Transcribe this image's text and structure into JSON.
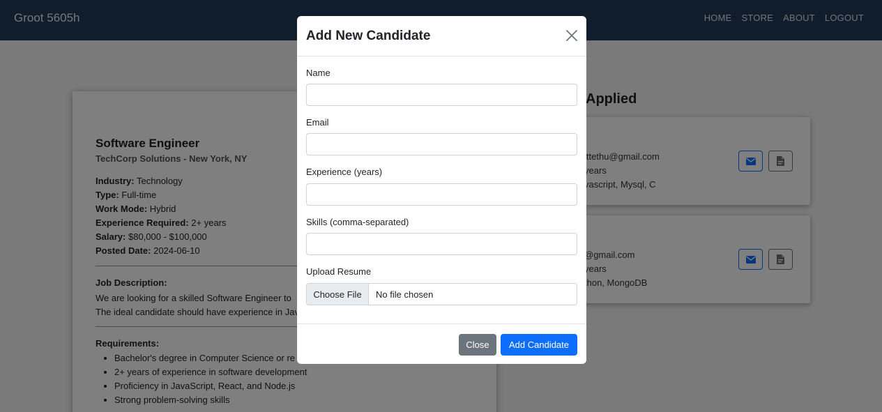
{
  "navbar": {
    "brand": "Groot 5605h",
    "links": [
      "HOME",
      "STORE",
      "ABOUT",
      "LOGOUT"
    ]
  },
  "job": {
    "title": "Software Engineer",
    "company": "TechCorp Solutions - New York, NY",
    "details": [
      {
        "label": "Industry:",
        "value": "Technology"
      },
      {
        "label": "Type:",
        "value": "Full-time"
      },
      {
        "label": "Work Mode:",
        "value": "Hybrid"
      },
      {
        "label": "Experience Required:",
        "value": "2+ years"
      },
      {
        "label": "Salary:",
        "value": "$80,000 - $100,000"
      },
      {
        "label": "Posted Date:",
        "value": "2024-06-10"
      }
    ],
    "description_label": "Job Description:",
    "description_lines": [
      "We are looking for a skilled Software Engineer to",
      "The ideal candidate should have experience in Jav"
    ],
    "requirements_label": "Requirements:",
    "requirements": [
      "Bachelor's degree in Computer Science or re",
      "2+ years of experience in software development",
      "Proficiency in JavaScript, React, and Node.js",
      "Strong problem-solving skills"
    ]
  },
  "applied": {
    "title": "Applied",
    "candidates": [
      {
        "email": "ittethu@gmail.com",
        "experience": "years",
        "skills": "vascript, Mysql, C"
      },
      {
        "email": "@gmail.com",
        "experience": "years",
        "skills": "thon, MongoDB"
      }
    ],
    "icons": {
      "mail": "envelope-icon",
      "pdf": "file-pdf-icon"
    }
  },
  "modal": {
    "title": "Add New Candidate",
    "close_icon": "close-icon",
    "fields": [
      {
        "label": "Name",
        "value": ""
      },
      {
        "label": "Email",
        "value": ""
      },
      {
        "label": "Experience (years)",
        "value": ""
      },
      {
        "label": "Skills (comma-separated)",
        "value": ""
      }
    ],
    "resume_label": "Upload Resume",
    "file_button": "Choose File",
    "file_status": "No file chosen",
    "close_button": "Close",
    "submit_button": "Add Candidate"
  },
  "colors": {
    "navbar": "#1f3a5a",
    "primary": "#0d6efd",
    "secondary": "#6c757d"
  }
}
